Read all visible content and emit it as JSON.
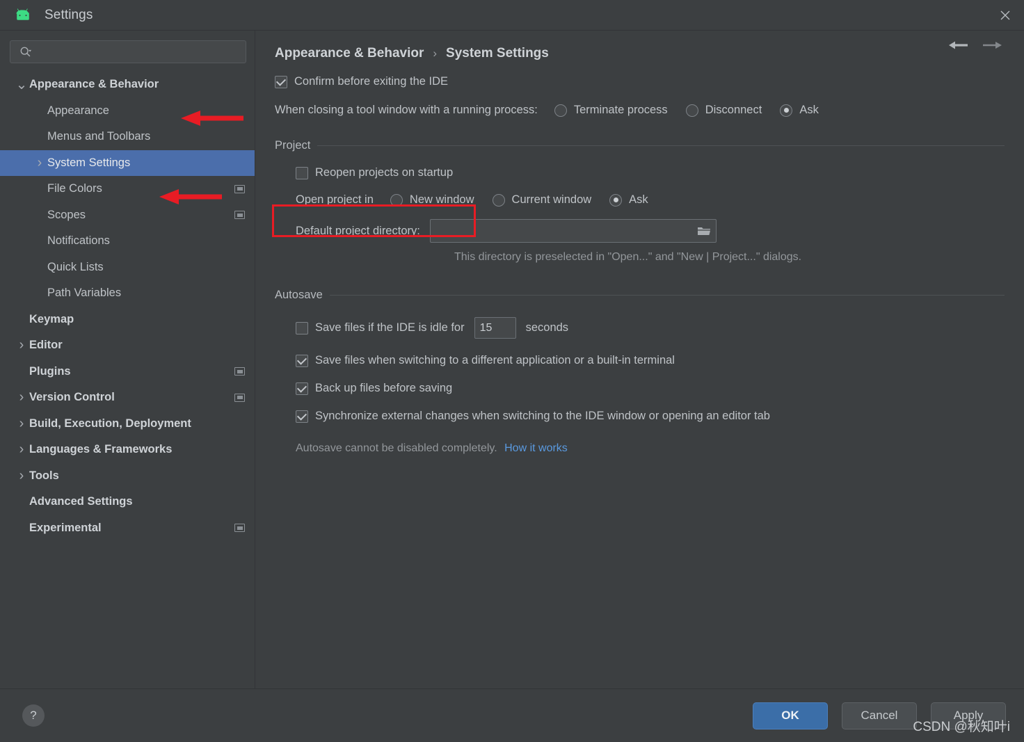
{
  "window": {
    "title": "Settings",
    "logo_icon": "android-logo-icon",
    "close_icon": "close-icon"
  },
  "search": {
    "value": "",
    "placeholder": "",
    "icon": "search-icon"
  },
  "sidebar": {
    "items": [
      {
        "label": "Appearance & Behavior",
        "indent": 0,
        "arrow": "down",
        "bold": true,
        "badge": false,
        "selected": false
      },
      {
        "label": "Appearance",
        "indent": 1,
        "arrow": "",
        "bold": false,
        "badge": false,
        "selected": false
      },
      {
        "label": "Menus and Toolbars",
        "indent": 1,
        "arrow": "",
        "bold": false,
        "badge": false,
        "selected": false
      },
      {
        "label": "System Settings",
        "indent": 1,
        "arrow": "right",
        "bold": false,
        "badge": false,
        "selected": true
      },
      {
        "label": "File Colors",
        "indent": 1,
        "arrow": "",
        "bold": false,
        "badge": true,
        "selected": false
      },
      {
        "label": "Scopes",
        "indent": 1,
        "arrow": "",
        "bold": false,
        "badge": true,
        "selected": false
      },
      {
        "label": "Notifications",
        "indent": 1,
        "arrow": "",
        "bold": false,
        "badge": false,
        "selected": false
      },
      {
        "label": "Quick Lists",
        "indent": 1,
        "arrow": "",
        "bold": false,
        "badge": false,
        "selected": false
      },
      {
        "label": "Path Variables",
        "indent": 1,
        "arrow": "",
        "bold": false,
        "badge": false,
        "selected": false
      },
      {
        "label": "Keymap",
        "indent": 0,
        "arrow": "",
        "bold": true,
        "badge": false,
        "selected": false
      },
      {
        "label": "Editor",
        "indent": 0,
        "arrow": "right",
        "bold": true,
        "badge": false,
        "selected": false
      },
      {
        "label": "Plugins",
        "indent": 0,
        "arrow": "",
        "bold": true,
        "badge": true,
        "selected": false
      },
      {
        "label": "Version Control",
        "indent": 0,
        "arrow": "right",
        "bold": true,
        "badge": true,
        "selected": false
      },
      {
        "label": "Build, Execution, Deployment",
        "indent": 0,
        "arrow": "right",
        "bold": true,
        "badge": false,
        "selected": false
      },
      {
        "label": "Languages & Frameworks",
        "indent": 0,
        "arrow": "right",
        "bold": true,
        "badge": false,
        "selected": false
      },
      {
        "label": "Tools",
        "indent": 0,
        "arrow": "right",
        "bold": true,
        "badge": false,
        "selected": false
      },
      {
        "label": "Advanced Settings",
        "indent": 0,
        "arrow": "",
        "bold": true,
        "badge": false,
        "selected": false
      },
      {
        "label": "Experimental",
        "indent": 0,
        "arrow": "",
        "bold": true,
        "badge": true,
        "selected": false
      }
    ]
  },
  "breadcrumb": {
    "parent": "Appearance & Behavior",
    "separator": "›",
    "current": "System Settings",
    "back_icon": "arrow-left-icon",
    "forward_icon": "arrow-right-icon"
  },
  "main": {
    "confirm_exit": {
      "label": "Confirm before exiting the IDE",
      "checked": true
    },
    "closing_tool_window": {
      "label": "When closing a tool window with a running process:",
      "options": [
        {
          "label": "Terminate process",
          "selected": false
        },
        {
          "label": "Disconnect",
          "selected": false
        },
        {
          "label": "Ask",
          "selected": true
        }
      ]
    },
    "project": {
      "group_title": "Project",
      "reopen": {
        "label": "Reopen projects on startup",
        "checked": false,
        "highlighted": true
      },
      "open_project_in": {
        "label": "Open project in",
        "options": [
          {
            "label": "New window",
            "selected": false
          },
          {
            "label": "Current window",
            "selected": false
          },
          {
            "label": "Ask",
            "selected": true
          }
        ]
      },
      "default_dir": {
        "label": "Default project directory:",
        "value": "",
        "placeholder": "",
        "browse_icon": "folder-icon",
        "hint": "This directory is preselected in \"Open...\" and \"New | Project...\" dialogs."
      }
    },
    "autosave": {
      "group_title": "Autosave",
      "idle": {
        "label_before": "Save files if the IDE is idle for",
        "value": "15",
        "label_after": "seconds",
        "checked": false
      },
      "checkboxes": [
        {
          "label": "Save files when switching to a different application or a built-in terminal",
          "checked": true
        },
        {
          "label": "Back up files before saving",
          "checked": true
        },
        {
          "label": "Synchronize external changes when switching to the IDE window or opening an editor tab",
          "checked": true
        }
      ],
      "note": "Autosave cannot be disabled completely.",
      "link": "How it works"
    }
  },
  "footer": {
    "help_label": "?",
    "ok": "OK",
    "cancel": "Cancel",
    "apply": "Apply"
  },
  "watermark": "CSDN @秋知叶i",
  "colors": {
    "selection_blue": "#4b6eab",
    "annotation_red": "#e81c24",
    "primary_button": "#3b6ea8",
    "link_blue": "#5a9ae0",
    "panel_bg": "#3c3f41"
  }
}
